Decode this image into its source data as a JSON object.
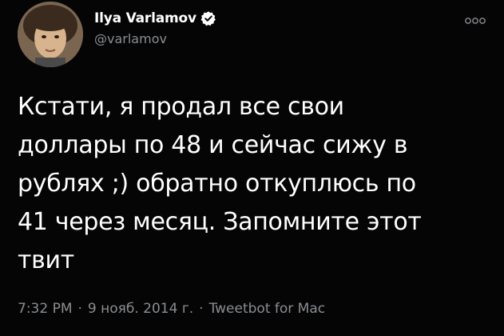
{
  "tweet": {
    "author": {
      "display_name": "Ilya Varlamov",
      "handle": "@varlamov",
      "verified": true,
      "verified_color": "#ffffff"
    },
    "more_icon": "more-options-icon",
    "text": "Кстати, я продал все свои\nдоллары по 48 и сейчас сижу в\nрублях ;) обратно откуплюсь по\n41 через месяц. Запомните этот\nтвит",
    "meta": {
      "time": "7:32 PM",
      "separator": "·",
      "date": "9 нояб. 2014 г.",
      "source": "Tweetbot for Mac"
    }
  },
  "colors": {
    "background": "#050505",
    "primary_text": "#ffffff",
    "secondary_text": "#8a8d91"
  }
}
